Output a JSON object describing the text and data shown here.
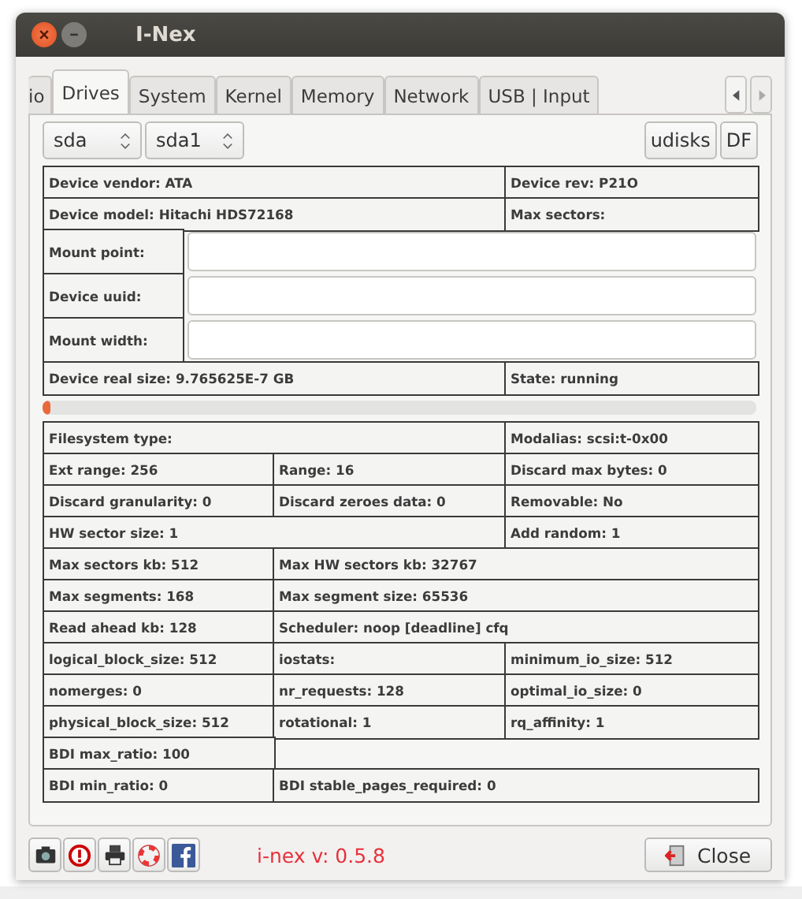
{
  "window": {
    "title": "I-Nex"
  },
  "tabs": [
    {
      "label": "io",
      "selected": false
    },
    {
      "label": "Drives",
      "selected": true
    },
    {
      "label": "System",
      "selected": false
    },
    {
      "label": "Kernel",
      "selected": false
    },
    {
      "label": "Memory",
      "selected": false
    },
    {
      "label": "Network",
      "selected": false
    },
    {
      "label": "USB | Input",
      "selected": false
    }
  ],
  "selectors": [
    {
      "value": "sda"
    },
    {
      "value": "sda1"
    }
  ],
  "buttons": [
    "udisks",
    "DF"
  ],
  "rows": [
    {
      "kind": "wide_narrow",
      "cells": [
        "Device vendor: ATA",
        "Device rev: P21O"
      ]
    },
    {
      "kind": "wide_narrow",
      "cells": [
        "Device model: Hitachi HDS72168",
        "Max sectors:"
      ]
    },
    {
      "kind": "field",
      "label": "Mount point:"
    },
    {
      "kind": "field",
      "label": "Device uuid:"
    },
    {
      "kind": "field",
      "label": "Mount width:"
    },
    {
      "kind": "wide_narrow",
      "cells": [
        "Device real size: 9.765625E-7 GB",
        "State: running"
      ]
    },
    {
      "kind": "progress",
      "level": 0.01
    },
    {
      "kind": "wide_narrow",
      "cells": [
        "Filesystem type:",
        "Modalias: scsi:t-0x00"
      ]
    },
    {
      "kind": "three",
      "cells": [
        "Ext range: 256",
        "Range: 16",
        "Discard max bytes: 0"
      ]
    },
    {
      "kind": "three",
      "cells": [
        "Discard granularity: 0",
        "Discard zeroes data: 0",
        "Removable: No"
      ]
    },
    {
      "kind": "wide_narrow",
      "cells": [
        "HW sector size: 1",
        "Add random: 1"
      ]
    },
    {
      "kind": "narrow_wide",
      "cells": [
        "Max sectors kb: 512",
        "Max HW sectors kb: 32767"
      ]
    },
    {
      "kind": "narrow_wide",
      "cells": [
        "Max segments: 168",
        "Max segment size: 65536"
      ]
    },
    {
      "kind": "narrow_wide",
      "cells": [
        "Read ahead kb: 128",
        "Scheduler: noop [deadline] cfq"
      ]
    },
    {
      "kind": "three",
      "cells": [
        "logical_block_size: 512",
        "iostats:",
        "minimum_io_size: 512"
      ]
    },
    {
      "kind": "three",
      "cells": [
        "nomerges: 0",
        "nr_requests: 128",
        "optimal_io_size: 0"
      ]
    },
    {
      "kind": "three",
      "cells": [
        "physical_block_size: 512",
        "rotational: 1",
        "rq_affinity: 1"
      ]
    },
    {
      "kind": "single",
      "cells": [
        "BDI max_ratio: 100"
      ]
    },
    {
      "kind": "narrow_wide",
      "cells": [
        "BDI min_ratio: 0",
        "BDI stable_pages_required: 0"
      ]
    }
  ],
  "footer": {
    "version": "i-nex v: 0.5.8",
    "close": "Close"
  }
}
